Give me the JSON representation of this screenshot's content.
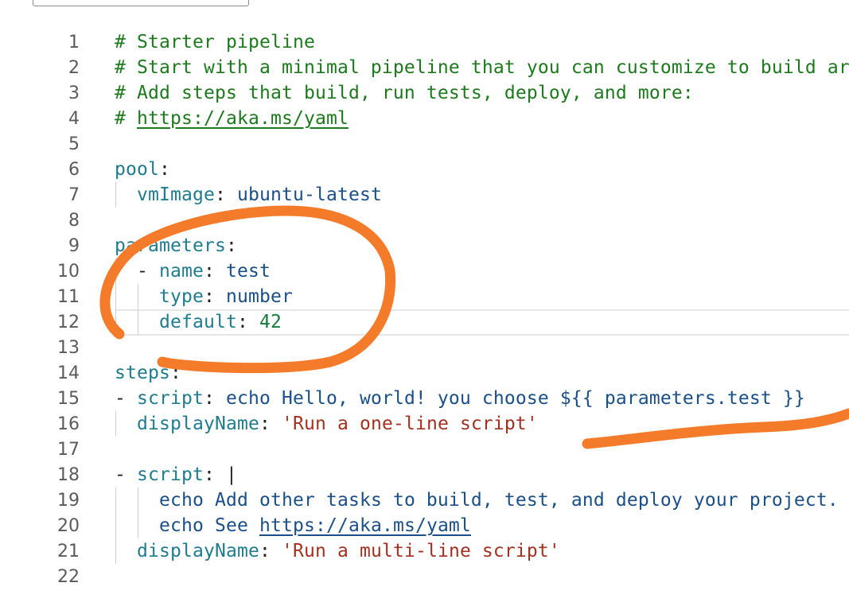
{
  "editor": {
    "lines": [
      {
        "n": "1",
        "tokens": [
          {
            "c": "com",
            "t": "# Starter pipeline"
          }
        ]
      },
      {
        "n": "2",
        "tokens": [
          {
            "c": "com",
            "t": "# Start with a minimal pipeline that you can customize to build ar"
          }
        ]
      },
      {
        "n": "3",
        "tokens": [
          {
            "c": "com",
            "t": "# Add steps that build, run tests, deploy, and more:"
          }
        ]
      },
      {
        "n": "4",
        "tokens": [
          {
            "c": "com",
            "t": "# "
          },
          {
            "c": "link",
            "t": "https://aka.ms/yaml"
          }
        ]
      },
      {
        "n": "5",
        "tokens": []
      },
      {
        "n": "6",
        "tokens": [
          {
            "c": "key",
            "t": "pool"
          },
          {
            "c": "punc",
            "t": ":"
          }
        ]
      },
      {
        "n": "7",
        "tokens": [
          {
            "c": "punc",
            "t": "  "
          },
          {
            "c": "key",
            "t": "vmImage"
          },
          {
            "c": "punc",
            "t": ": "
          },
          {
            "c": "val",
            "t": "ubuntu-latest"
          }
        ],
        "guides": [
          1
        ]
      },
      {
        "n": "8",
        "tokens": []
      },
      {
        "n": "9",
        "tokens": [
          {
            "c": "key",
            "t": "parameters"
          },
          {
            "c": "punc",
            "t": ":"
          }
        ]
      },
      {
        "n": "10",
        "tokens": [
          {
            "c": "punc",
            "t": "  - "
          },
          {
            "c": "key",
            "t": "name"
          },
          {
            "c": "punc",
            "t": ": "
          },
          {
            "c": "val",
            "t": "test"
          }
        ],
        "guides": [
          1
        ]
      },
      {
        "n": "11",
        "tokens": [
          {
            "c": "punc",
            "t": "    "
          },
          {
            "c": "key",
            "t": "type"
          },
          {
            "c": "punc",
            "t": ": "
          },
          {
            "c": "val",
            "t": "number"
          }
        ],
        "guides": [
          1,
          2
        ]
      },
      {
        "n": "12",
        "tokens": [
          {
            "c": "punc",
            "t": "    "
          },
          {
            "c": "key",
            "t": "default"
          },
          {
            "c": "punc",
            "t": ": "
          },
          {
            "c": "num",
            "t": "42"
          }
        ],
        "guides": [
          1,
          2
        ]
      },
      {
        "n": "13",
        "tokens": []
      },
      {
        "n": "14",
        "tokens": [
          {
            "c": "key",
            "t": "steps"
          },
          {
            "c": "punc",
            "t": ":"
          }
        ]
      },
      {
        "n": "15",
        "tokens": [
          {
            "c": "punc",
            "t": "- "
          },
          {
            "c": "key",
            "t": "script"
          },
          {
            "c": "punc",
            "t": ": "
          },
          {
            "c": "val",
            "t": "echo Hello, world! you choose ${{ parameters.test }}"
          }
        ]
      },
      {
        "n": "16",
        "tokens": [
          {
            "c": "punc",
            "t": "  "
          },
          {
            "c": "key",
            "t": "displayName"
          },
          {
            "c": "punc",
            "t": ": "
          },
          {
            "c": "str",
            "t": "'Run a one-line script'"
          }
        ],
        "guides": [
          1
        ]
      },
      {
        "n": "17",
        "tokens": []
      },
      {
        "n": "18",
        "tokens": [
          {
            "c": "punc",
            "t": "- "
          },
          {
            "c": "key",
            "t": "script"
          },
          {
            "c": "punc",
            "t": ": |"
          }
        ]
      },
      {
        "n": "19",
        "tokens": [
          {
            "c": "punc",
            "t": "    "
          },
          {
            "c": "val",
            "t": "echo Add other tasks to build, test, and deploy your project."
          }
        ],
        "guides": [
          1,
          2
        ]
      },
      {
        "n": "20",
        "tokens": [
          {
            "c": "punc",
            "t": "    "
          },
          {
            "c": "val",
            "t": "echo See "
          },
          {
            "c": "link2",
            "t": "https://aka.ms/yaml"
          }
        ],
        "guides": [
          1,
          2
        ]
      },
      {
        "n": "21",
        "tokens": [
          {
            "c": "punc",
            "t": "  "
          },
          {
            "c": "key",
            "t": "displayName"
          },
          {
            "c": "punc",
            "t": ": "
          },
          {
            "c": "str",
            "t": "'Run a multi-line script'"
          }
        ],
        "guides": [
          1
        ]
      },
      {
        "n": "22",
        "tokens": []
      }
    ]
  },
  "colors": {
    "comment": "#1c7a1c",
    "key": "#1e7c8e",
    "value": "#1b4f87",
    "string": "#a4301f",
    "number": "#137b3c",
    "annotation": "#f47b2a"
  }
}
